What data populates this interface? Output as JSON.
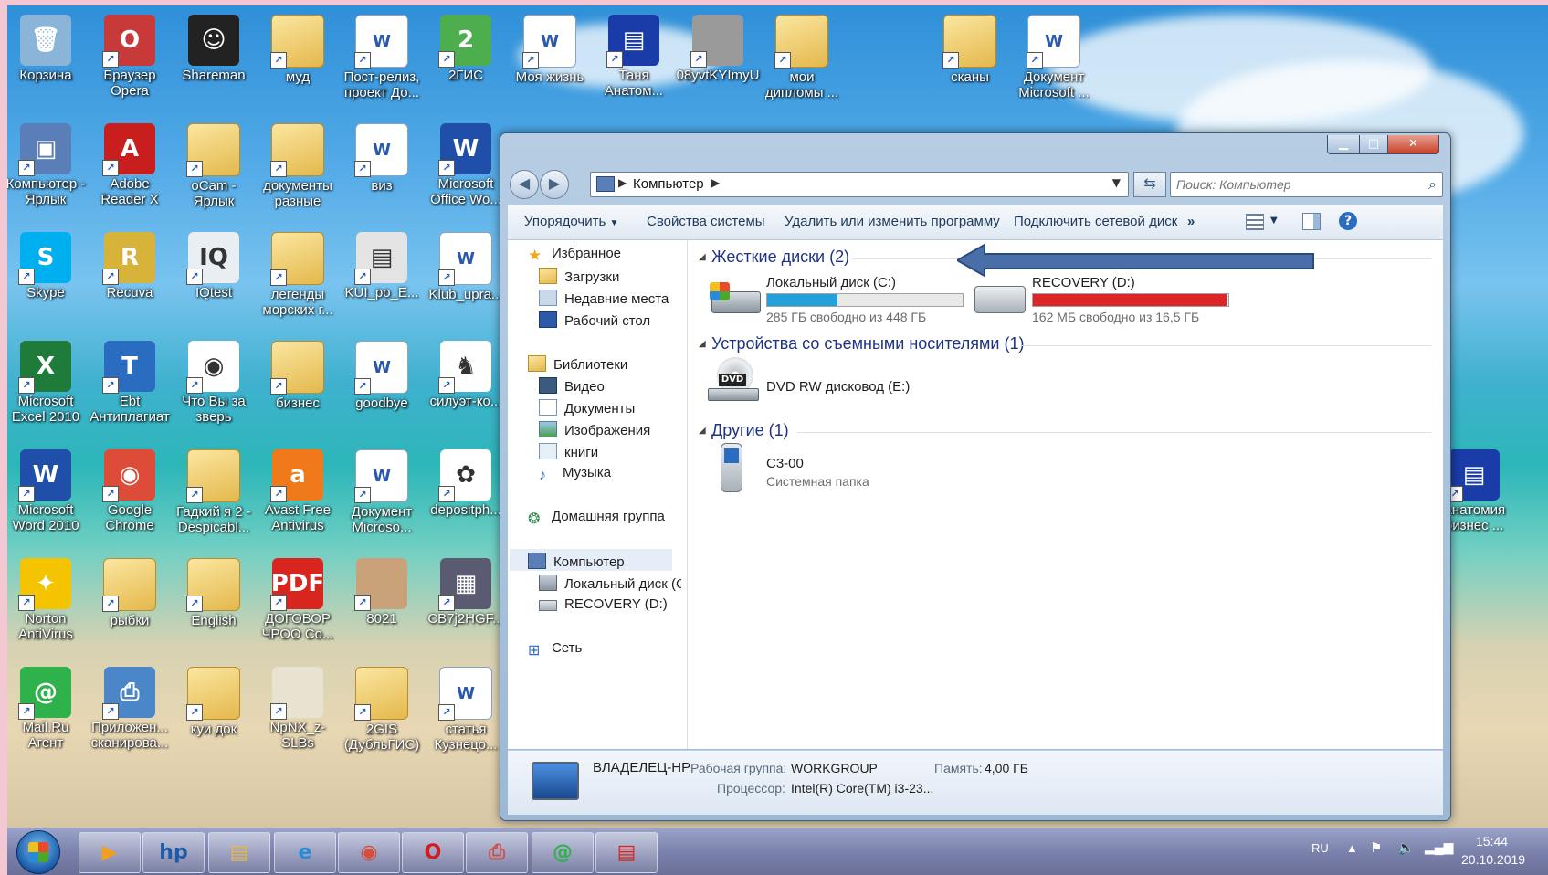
{
  "desktop": {
    "icons": [
      {
        "label": "Корзина",
        "glyph": "🗑",
        "color": "#8ab4d8"
      },
      {
        "label": "Браузер Opera",
        "glyph": "O",
        "color": "#c83a3a"
      },
      {
        "label": "Shareman",
        "glyph": "☺",
        "color": "#222"
      },
      {
        "label": "муд",
        "glyph": "",
        "color": "folder"
      },
      {
        "label": "Пост-релиз, проект До...",
        "glyph": "W",
        "color": "doc"
      },
      {
        "label": "2ГИС",
        "glyph": "2",
        "color": "#4cae4c"
      },
      {
        "label": "Моя жизнь",
        "glyph": "W",
        "color": "doc"
      },
      {
        "label": "Таня Анатом...",
        "glyph": "▤",
        "color": "#1a3ca8"
      },
      {
        "label": "08yvtKYImyU",
        "glyph": "",
        "color": "#9a9a9a"
      },
      {
        "label": "мои дипломы ...",
        "glyph": "",
        "color": "folder"
      },
      {
        "label": "сканы",
        "glyph": "",
        "color": "folder"
      },
      {
        "label": "Документ Microsoft ...",
        "glyph": "W",
        "color": "doc"
      },
      {
        "label": "Компьютер - Ярлык",
        "glyph": "▣",
        "color": "#5a7fb8"
      },
      {
        "label": "Adobe Reader X",
        "glyph": "A",
        "color": "#c81e1e"
      },
      {
        "label": "oCam - Ярлык",
        "glyph": "",
        "color": "folder"
      },
      {
        "label": "документы разные",
        "glyph": "",
        "color": "folder"
      },
      {
        "label": "виз",
        "glyph": "W",
        "color": "doc"
      },
      {
        "label": "Microsoft Office Wo...",
        "glyph": "W",
        "color": "#1f4fa8"
      },
      {
        "label": "Skype",
        "glyph": "S",
        "color": "#00aff0"
      },
      {
        "label": "Recuva",
        "glyph": "R",
        "color": "#d8b33a"
      },
      {
        "label": "IQtest",
        "glyph": "IQ",
        "color": "#e8eef2"
      },
      {
        "label": "легенды морских г...",
        "glyph": "",
        "color": "folder"
      },
      {
        "label": "KUI_po_E...",
        "glyph": "▤",
        "color": "#e4e4e4"
      },
      {
        "label": "Klub_upra...",
        "glyph": "W",
        "color": "doc"
      },
      {
        "label": "Microsoft Excel 2010",
        "glyph": "X",
        "color": "#1e7b3a"
      },
      {
        "label": "Ebt Антиплагиат",
        "glyph": "T",
        "color": "#2a6cc0"
      },
      {
        "label": "Что Вы за зверь",
        "glyph": "◉",
        "color": "#ffffff"
      },
      {
        "label": "бизнес",
        "glyph": "",
        "color": "folder"
      },
      {
        "label": "goodbye",
        "glyph": "W",
        "color": "doc"
      },
      {
        "label": "силуэт-ко...",
        "glyph": "♞",
        "color": "#ffffff"
      },
      {
        "label": "Microsoft Word 2010",
        "glyph": "W",
        "color": "#1f4fa8"
      },
      {
        "label": "Google Chrome",
        "glyph": "◉",
        "color": "#dd4b39"
      },
      {
        "label": "Гадкий я 2 - Despicabl...",
        "glyph": "",
        "color": "folder"
      },
      {
        "label": "Avast Free Antivirus",
        "glyph": "a",
        "color": "#f07a1a"
      },
      {
        "label": "Документ Microso...",
        "glyph": "W",
        "color": "doc"
      },
      {
        "label": "depositph...",
        "glyph": "✿",
        "color": "#ffffff"
      },
      {
        "label": "Анатомия бизнес ...",
        "glyph": "▤",
        "color": "#1a3ca8"
      },
      {
        "label": "Norton AntiVirus",
        "glyph": "✦",
        "color": "#f5c400"
      },
      {
        "label": "рыбки",
        "glyph": "",
        "color": "folder"
      },
      {
        "label": "English",
        "glyph": "",
        "color": "folder"
      },
      {
        "label": "ДОГОВОР ЧРОО Со...",
        "glyph": "PDF",
        "color": "#d8261e"
      },
      {
        "label": "8021",
        "glyph": "",
        "color": "#c9a27a"
      },
      {
        "label": "CB7j2HGF...",
        "glyph": "▦",
        "color": "#5a5a70"
      },
      {
        "label": "Mail.Ru Агент",
        "glyph": "@",
        "color": "#2fb24c"
      },
      {
        "label": "Приложен... сканирова...",
        "glyph": "⎙",
        "color": "#4a86c8"
      },
      {
        "label": "куи док",
        "glyph": "",
        "color": "folder"
      },
      {
        "label": "NpNX_z-SLBs",
        "glyph": "",
        "color": "#e8e2d0"
      },
      {
        "label": "2GIS (ДубльГИС)",
        "glyph": "",
        "color": "folder"
      },
      {
        "label": "статья Кузнецо...",
        "glyph": "W",
        "color": "doc"
      }
    ]
  },
  "explorer": {
    "window_buttons": {
      "minimize": "▁",
      "maximize": "□",
      "close": "✕"
    },
    "address": {
      "computer": "Компьютер"
    },
    "search": {
      "placeholder": "Поиск: Компьютер"
    },
    "toolbar": {
      "organize": "Упорядочить",
      "system_properties": "Свойства системы",
      "uninstall": "Удалить или изменить программу",
      "map_drive": "Подключить сетевой диск",
      "more": "»"
    },
    "nav": {
      "favorites": "Избранное",
      "downloads": "Загрузки",
      "recent": "Недавние места",
      "desktop": "Рабочий стол",
      "libraries": "Библиотеки",
      "video": "Видео",
      "documents": "Документы",
      "pictures": "Изображения",
      "books": "книги",
      "music": "Музыка",
      "homegroup": "Домашняя группа",
      "computer": "Компьютер",
      "local_c": "Локальный диск (C:)",
      "recovery_d": "RECOVERY (D:)",
      "network": "Сеть"
    },
    "groups": {
      "hard_drives": "Жесткие диски (2)",
      "removable": "Устройства со съемными носителями (1)",
      "other": "Другие (1)"
    },
    "drives": [
      {
        "name": "Локальный диск (C:)",
        "free": "285 ГБ свободно из 448 ГБ",
        "used_fraction": 0.36,
        "bar_color": "#26a0da"
      },
      {
        "name": "RECOVERY (D:)",
        "free": "162 МБ свободно из 16,5 ГБ",
        "used_fraction": 0.99,
        "bar_color": "#da2626"
      }
    ],
    "dvd": {
      "name": "DVD RW дисковод (E:)",
      "badge": "DVD"
    },
    "other_item": {
      "name": "C3-00",
      "sub": "Системная папка"
    },
    "details": {
      "pc_name": "ВЛАДЕЛЕЦ-HP",
      "workgroup_label": "Рабочая группа:",
      "workgroup": "WORKGROUP",
      "memory_label": "Память:",
      "memory": "4,00 ГБ",
      "cpu_label": "Процессор:",
      "cpu": "Intel(R) Core(TM) i3-23..."
    }
  },
  "taskbar": {
    "buttons": [
      {
        "name": "media-player-icon",
        "glyph": "▶",
        "color": "#f0a020"
      },
      {
        "name": "hp-icon",
        "glyph": "hp",
        "color": "#1d5aa8"
      },
      {
        "name": "explorer-icon",
        "glyph": "▤",
        "color": "#e4b84c"
      },
      {
        "name": "ie-icon",
        "glyph": "e",
        "color": "#2a8ad8"
      },
      {
        "name": "chrome-icon",
        "glyph": "◉",
        "color": "#dd4b39"
      },
      {
        "name": "opera-icon",
        "glyph": "O",
        "color": "#d41c1c"
      },
      {
        "name": "scanner-icon",
        "glyph": "⎙",
        "color": "#c8504a"
      },
      {
        "name": "mailru-agent-icon",
        "glyph": "@",
        "color": "#2fb24c"
      },
      {
        "name": "reader-icon",
        "glyph": "▤",
        "color": "#d8261e"
      }
    ],
    "lang": "RU",
    "time": "15:44",
    "date": "20.10.2019"
  }
}
